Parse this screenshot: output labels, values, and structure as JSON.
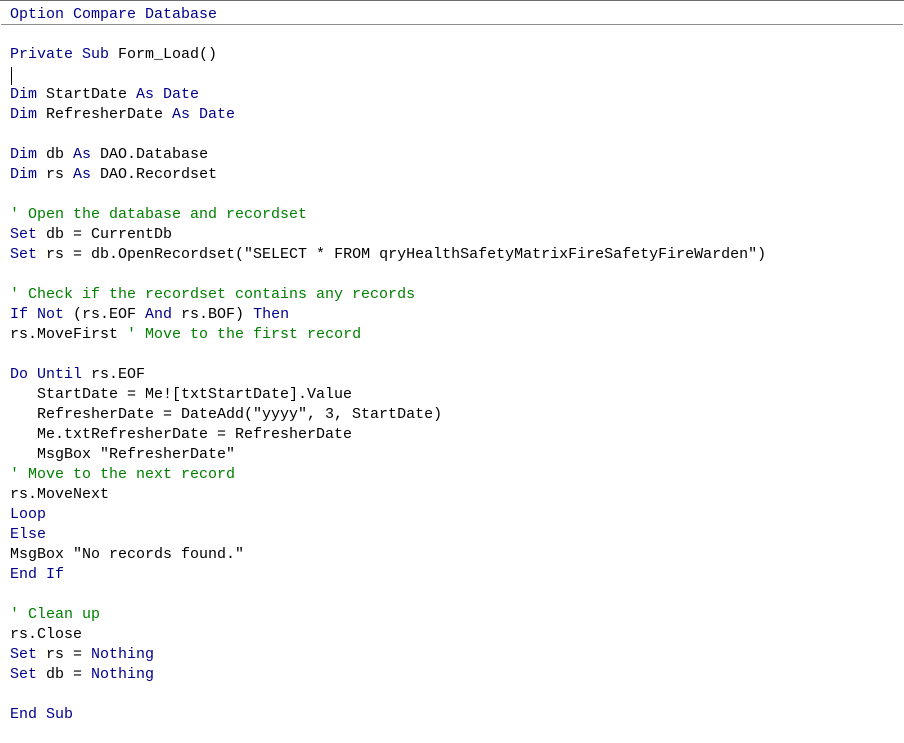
{
  "editor": {
    "lines": [
      {
        "segments": [
          {
            "k": "kw",
            "t": "Option Compare Database"
          }
        ]
      },
      {
        "segments": [
          {
            "k": "kw",
            "t": "Private Sub "
          },
          {
            "k": "tx",
            "t": "Form_Load()"
          }
        ]
      },
      {
        "segments": [
          {
            "k": "kw",
            "t": "Dim "
          },
          {
            "k": "tx",
            "t": "StartDate "
          },
          {
            "k": "kw",
            "t": "As Date"
          }
        ]
      },
      {
        "segments": [
          {
            "k": "kw",
            "t": "Dim "
          },
          {
            "k": "tx",
            "t": "RefresherDate "
          },
          {
            "k": "kw",
            "t": "As Date"
          }
        ]
      },
      {
        "segments": [
          {
            "k": "kw",
            "t": "Dim "
          },
          {
            "k": "tx",
            "t": "db "
          },
          {
            "k": "kw",
            "t": "As "
          },
          {
            "k": "tx",
            "t": "DAO.Database"
          }
        ]
      },
      {
        "segments": [
          {
            "k": "kw",
            "t": "Dim "
          },
          {
            "k": "tx",
            "t": "rs "
          },
          {
            "k": "kw",
            "t": "As "
          },
          {
            "k": "tx",
            "t": "DAO.Recordset"
          }
        ]
      },
      {
        "segments": [
          {
            "k": "cm",
            "t": "' Open the database and recordset"
          }
        ]
      },
      {
        "segments": [
          {
            "k": "kw",
            "t": "Set "
          },
          {
            "k": "tx",
            "t": "db = CurrentDb"
          }
        ]
      },
      {
        "segments": [
          {
            "k": "kw",
            "t": "Set "
          },
          {
            "k": "tx",
            "t": "rs = db.OpenRecordset(\"SELECT * FROM qryHealthSafetyMatrixFireSafetyFireWarden\")"
          }
        ]
      },
      {
        "segments": [
          {
            "k": "cm",
            "t": "' Check if the recordset contains any records"
          }
        ]
      },
      {
        "segments": [
          {
            "k": "kw",
            "t": "If Not "
          },
          {
            "k": "tx",
            "t": "(rs.EOF "
          },
          {
            "k": "kw",
            "t": "And "
          },
          {
            "k": "tx",
            "t": "rs.BOF) "
          },
          {
            "k": "kw",
            "t": "Then"
          }
        ]
      },
      {
        "segments": [
          {
            "k": "tx",
            "t": "rs.MoveFirst "
          },
          {
            "k": "cm",
            "t": "' Move to the first record"
          }
        ]
      },
      {
        "segments": [
          {
            "k": "kw",
            "t": "Do Until "
          },
          {
            "k": "tx",
            "t": "rs.EOF"
          }
        ]
      },
      {
        "segments": [
          {
            "k": "tx",
            "t": "   StartDate = Me![txtStartDate].Value"
          }
        ]
      },
      {
        "segments": [
          {
            "k": "tx",
            "t": "   RefresherDate = DateAdd(\"yyyy\", 3, StartDate)"
          }
        ]
      },
      {
        "segments": [
          {
            "k": "tx",
            "t": "   Me.txtRefresherDate = RefresherDate"
          }
        ]
      },
      {
        "segments": [
          {
            "k": "tx",
            "t": "   MsgBox \"RefresherDate\""
          }
        ]
      },
      {
        "segments": [
          {
            "k": "cm",
            "t": "' Move to the next record"
          }
        ]
      },
      {
        "segments": [
          {
            "k": "tx",
            "t": "rs.MoveNext"
          }
        ]
      },
      {
        "segments": [
          {
            "k": "kw",
            "t": "Loop"
          }
        ]
      },
      {
        "segments": [
          {
            "k": "kw",
            "t": "Else"
          }
        ]
      },
      {
        "segments": [
          {
            "k": "tx",
            "t": "MsgBox \"No records found.\""
          }
        ]
      },
      {
        "segments": [
          {
            "k": "kw",
            "t": "End If"
          }
        ]
      },
      {
        "segments": [
          {
            "k": "cm",
            "t": "' Clean up"
          }
        ]
      },
      {
        "segments": [
          {
            "k": "tx",
            "t": "rs.Close"
          }
        ]
      },
      {
        "segments": [
          {
            "k": "kw",
            "t": "Set "
          },
          {
            "k": "tx",
            "t": "rs = "
          },
          {
            "k": "kw",
            "t": "Nothing"
          }
        ]
      },
      {
        "segments": [
          {
            "k": "kw",
            "t": "Set "
          },
          {
            "k": "tx",
            "t": "db = "
          },
          {
            "k": "kw",
            "t": "Nothing"
          }
        ]
      },
      {
        "segments": [
          {
            "k": "kw",
            "t": "End Sub"
          }
        ]
      }
    ]
  },
  "colors": {
    "keyword": "#00008b",
    "comment": "#008000",
    "text": "#000000",
    "background": "#ffffff"
  }
}
